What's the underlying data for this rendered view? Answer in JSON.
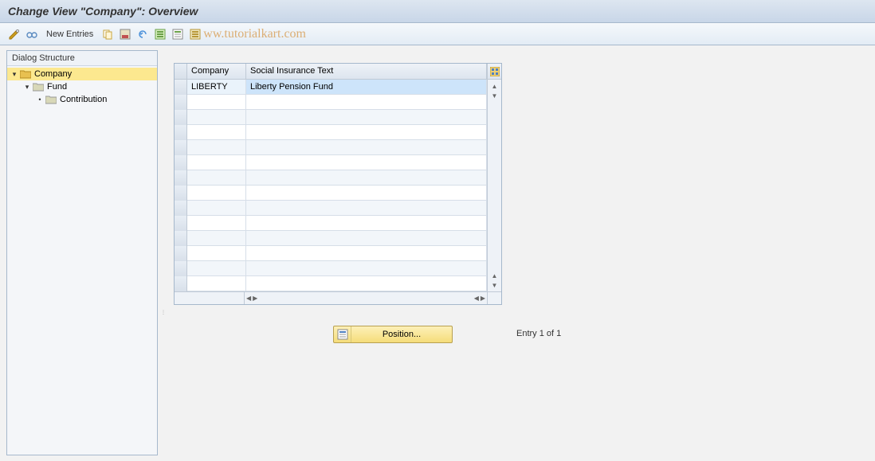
{
  "title": "Change View \"Company\": Overview",
  "toolbar": {
    "new_entries_label": "New Entries"
  },
  "watermark": "ww.tutorialkart.com",
  "sidebar": {
    "header": "Dialog Structure",
    "items": [
      {
        "label": "Company",
        "level": 0,
        "expanded": true,
        "selected": true,
        "open_folder": true
      },
      {
        "label": "Fund",
        "level": 1,
        "expanded": true,
        "selected": false,
        "open_folder": false
      },
      {
        "label": "Contribution",
        "level": 2,
        "expanded": false,
        "selected": false,
        "open_folder": false
      }
    ]
  },
  "grid": {
    "columns": [
      "Company",
      "Social Insurance Text"
    ],
    "rows": [
      {
        "company": "LIBERTY",
        "text": "Liberty Pension Fund"
      }
    ],
    "empty_row_count": 13
  },
  "position_button_label": "Position...",
  "entry_status": "Entry 1 of 1"
}
